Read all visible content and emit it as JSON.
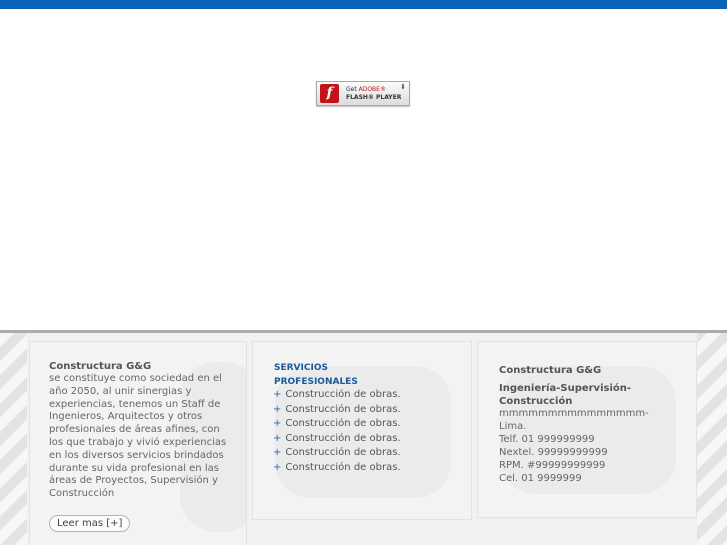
{
  "header": {
    "accent_color": "#0a63b8"
  },
  "flash_badge": {
    "line1_prefix": "Get ",
    "line1_brand": "ADOBE®",
    "line2": "FLASH® PLAYER",
    "logo_letter": "f",
    "icon": "flash-logo-icon"
  },
  "footer": {
    "about": {
      "title": "Constructura G&G",
      "body": "se constituye como sociedad en el año 2050, al unir sinergias y experiencias, tenemos un Staff de Ingenieros, Arquitectos y otros profesionales de áreas afines, con los que trabajo y vivió experiencias en los diversos servicios brindados durante su vida profesional en las áreas de Proyectos, Supervisión y Construcción",
      "button_label": "Leer mas [+]"
    },
    "services": {
      "title_line1": "SERVICIOS",
      "title_line2": "PROFESIONALES",
      "bullet": "+",
      "items": [
        "Construcción de obras.",
        "Construcción de obras.",
        "Construcción de obras.",
        "Construcción de obras.",
        "Construcción de obras.",
        "Construcción de obras."
      ]
    },
    "contact": {
      "title": "Constructura G&G",
      "subtitle": "Ingeniería-Supervisión-Construcción",
      "lines": [
        "mmmmmmmmmmmmmmm-",
        "Lima.",
        "Telf. 01 999999999",
        "Nextel. 99999999999",
        "RPM. #99999999999",
        "Cel. 01 9999999"
      ]
    }
  }
}
